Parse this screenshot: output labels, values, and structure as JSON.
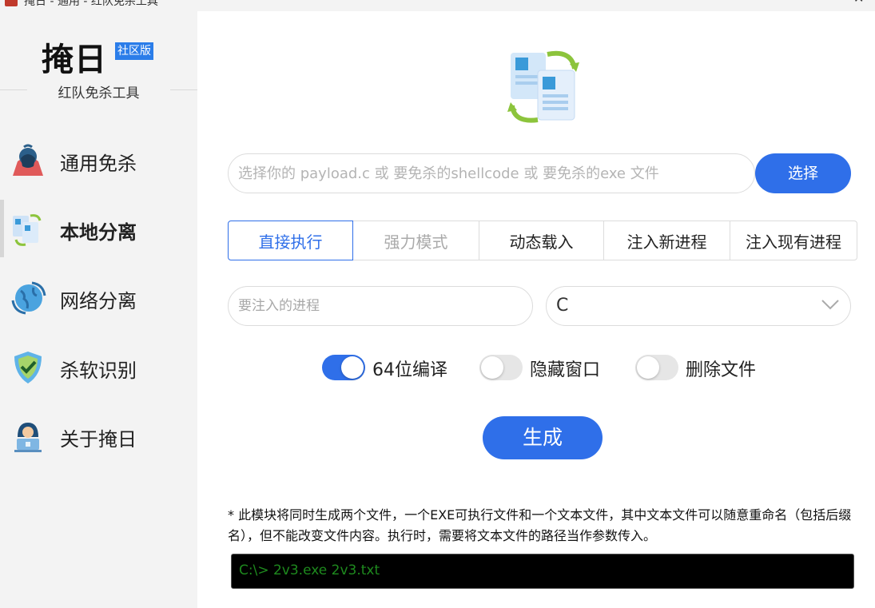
{
  "window": {
    "title": "掩日 - 通用 - 红队免杀工具"
  },
  "sidebar": {
    "brand": "掩日",
    "badge": "社区版",
    "subtitle": "红队免杀工具",
    "items": [
      {
        "label": "通用免杀",
        "icon": "hacker-icon",
        "active": false
      },
      {
        "label": "本地分离",
        "icon": "files-sync-icon",
        "active": true
      },
      {
        "label": "网络分离",
        "icon": "globe-icon",
        "active": false
      },
      {
        "label": "杀软识别",
        "icon": "shield-check-icon",
        "active": false
      },
      {
        "label": "关于掩日",
        "icon": "user-laptop-icon",
        "active": false
      }
    ]
  },
  "main": {
    "file_input": {
      "placeholder": "选择你的 payload.c 或 要免杀的shellcode 或 要免杀的exe 文件",
      "value": ""
    },
    "select_button": "选择",
    "tabs": [
      {
        "label": "直接执行",
        "state": "active"
      },
      {
        "label": "强力模式",
        "state": "disabled"
      },
      {
        "label": "动态载入",
        "state": "normal"
      },
      {
        "label": "注入新进程",
        "state": "normal"
      },
      {
        "label": "注入现有进程",
        "state": "normal"
      }
    ],
    "process_input": {
      "placeholder": "要注入的进程",
      "value": ""
    },
    "language_select": {
      "selected": "C"
    },
    "toggles": [
      {
        "label": "64位编译",
        "on": true
      },
      {
        "label": "隐藏窗口",
        "on": false
      },
      {
        "label": "删除文件",
        "on": false
      }
    ],
    "generate_button": "生成",
    "note": "* 此模块将同时生成两个文件，一个EXE可执行文件和一个文本文件，其中文本文件可以随意重命名（包括后缀名），但不能改变文件内容。执行时，需要将文本文件的路径当作参数传入。",
    "command_example": "C:\\> 2v3.exe 2v3.txt"
  },
  "colors": {
    "accent": "#2f6fe9",
    "badge": "#2b7de9",
    "sidebar_bg": "#f3f3f3",
    "terminal_text": "#1e8a1e"
  }
}
